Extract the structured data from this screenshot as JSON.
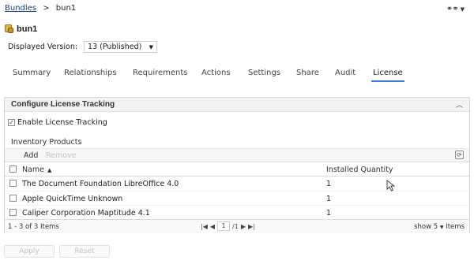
{
  "breadcrumb": {
    "parent": "Bundles",
    "separator": ">",
    "current": "bun1"
  },
  "header_menu": {
    "icon": "link-icon"
  },
  "page": {
    "title": "bun1",
    "icon": "bundle-icon"
  },
  "version": {
    "label": "Displayed Version:",
    "value": "13 (Published)"
  },
  "tabs": [
    {
      "label": "Summary"
    },
    {
      "label": "Relationships"
    },
    {
      "label": "Requirements"
    },
    {
      "label": "Actions"
    },
    {
      "label": "Settings"
    },
    {
      "label": "Share"
    },
    {
      "label": "Audit"
    },
    {
      "label": "License",
      "active": true
    }
  ],
  "panel": {
    "title": "Configure License Tracking",
    "enable_label": "Enable License Tracking",
    "enable_checked": true,
    "section_label": "Inventory Products",
    "toolbar": {
      "add": "Add",
      "remove": "Remove"
    },
    "grid": {
      "columns": {
        "name": "Name",
        "quantity": "Installed Quantity"
      },
      "rows": [
        {
          "name": "The Document Foundation LibreOffice 4.0",
          "quantity": "1"
        },
        {
          "name": "Apple QuickTime Unknown",
          "quantity": "1"
        },
        {
          "name": "Caliper Corporation Maptitude 4.1",
          "quantity": "1"
        }
      ]
    },
    "footer": {
      "count": "1 - 3 of 3 Items",
      "page": "1",
      "page_total": "/1",
      "show": "show",
      "page_size": "5",
      "items": "Items"
    }
  },
  "buttons": {
    "apply": "Apply",
    "reset": "Reset"
  },
  "colors": {
    "tab_underline": "#3c7dd9",
    "link": "#1f3f7a"
  }
}
